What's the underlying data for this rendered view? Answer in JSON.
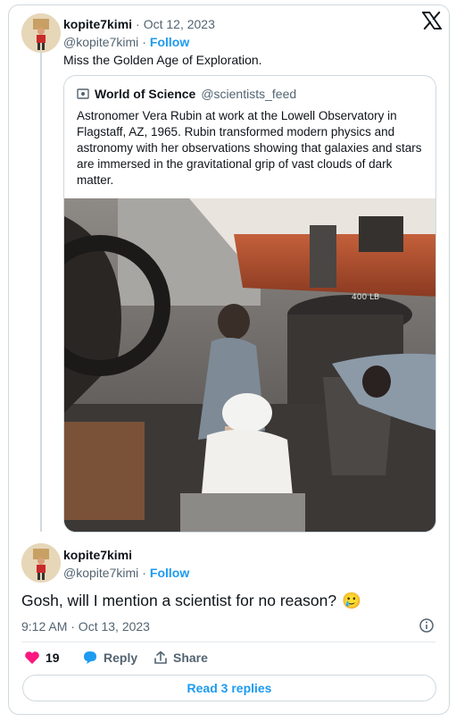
{
  "platform": "X",
  "original_tweet": {
    "display_name": "kopite7kimi",
    "date": "Oct 12, 2023",
    "handle": "@kopite7kimi",
    "follow_label": "Follow",
    "text": "Miss the Golden Age of Exploration."
  },
  "quoted_tweet": {
    "display_name": "World of Science",
    "handle": "@scientists_feed",
    "text": "Astronomer Vera Rubin at work at the Lowell Observatory in Flagstaff, AZ, 1965. Rubin transformed modern physics and astronomy with her observations showing that galaxies and stars are immersed in the gravitational grip of vast clouds of dark matter.",
    "photo_label": "400 LB"
  },
  "reply_tweet": {
    "display_name": "kopite7kimi",
    "handle": "@kopite7kimi",
    "follow_label": "Follow",
    "text": "Gosh, will I mention a scientist for no reason?",
    "emoji": "🥲",
    "timestamp": "9:12 AM · Oct 13, 2023"
  },
  "actions": {
    "like_count": "19",
    "reply_label": "Reply",
    "share_label": "Share",
    "read_replies_label": "Read 3 replies"
  },
  "colors": {
    "accent": "#1d9bf0",
    "like": "#f91880",
    "muted": "#536471",
    "border": "#cfd9de"
  }
}
